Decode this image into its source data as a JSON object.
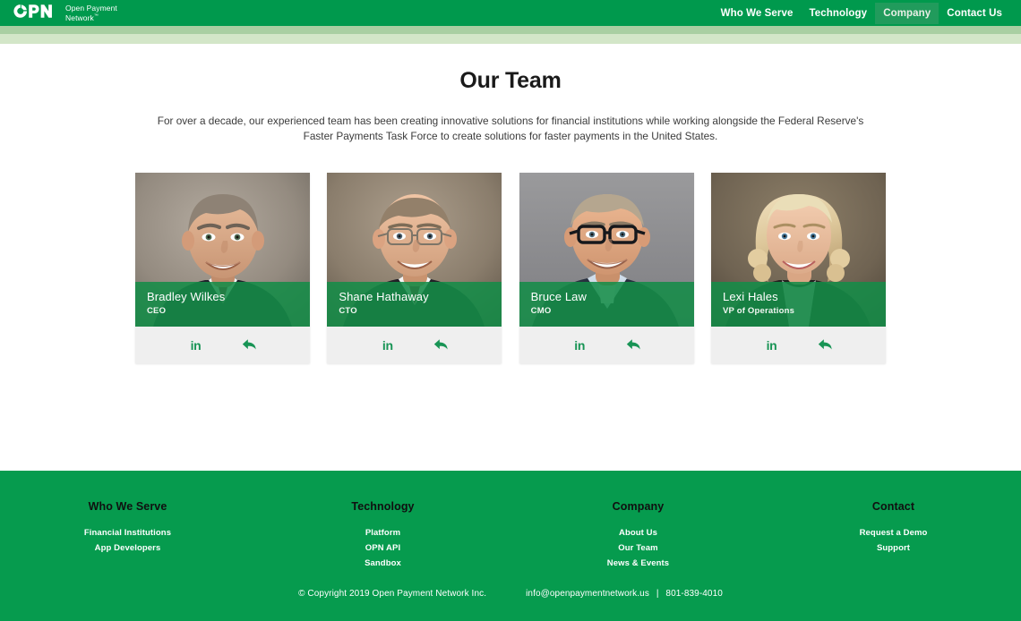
{
  "header": {
    "logo": {
      "mark": "opn-monogram",
      "line1": "Open Payment",
      "line2": "Network",
      "tm": "™"
    },
    "nav": [
      {
        "label": "Who We Serve",
        "active": false
      },
      {
        "label": "Technology",
        "active": false
      },
      {
        "label": "Company",
        "active": true
      },
      {
        "label": "Contact Us",
        "active": false
      }
    ]
  },
  "main": {
    "title": "Our Team",
    "subtitle": "For over a decade, our experienced team has been creating innovative solutions for financial institutions while working alongside the Federal Reserve's Faster Payments Task Force to create solutions for faster payments in the United States.",
    "team": [
      {
        "name": "Bradley Wilkes",
        "role": "CEO",
        "linkedin_label": "in",
        "share_label": "share-arrow"
      },
      {
        "name": "Shane Hathaway",
        "role": "CTO",
        "linkedin_label": "in",
        "share_label": "share-arrow"
      },
      {
        "name": "Bruce Law",
        "role": "CMO",
        "linkedin_label": "in",
        "share_label": "share-arrow"
      },
      {
        "name": "Lexi Hales",
        "role": "VP of Operations",
        "linkedin_label": "in",
        "share_label": "share-arrow"
      }
    ]
  },
  "footer": {
    "columns": [
      {
        "heading": "Who We Serve",
        "links": [
          "Financial Institutions",
          "App Developers"
        ]
      },
      {
        "heading": "Technology",
        "links": [
          "Platform",
          "OPN API",
          "Sandbox"
        ]
      },
      {
        "heading": "Company",
        "links": [
          "About Us",
          "Our Team",
          "News & Events"
        ]
      },
      {
        "heading": "Contact",
        "links": [
          "Request a Demo",
          "Support"
        ]
      }
    ],
    "copyright": "© Copyright 2019 Open Payment Network Inc.",
    "email": "info@openpaymentnetwork.us",
    "separator": "|",
    "phone": "801-839-4010"
  },
  "colors": {
    "header_green": "#00994d",
    "band_mid": "#a9cfa2",
    "band_light": "#d3e6c8",
    "footer_green": "#069b4e",
    "nameplate_green": "#148c48",
    "icon_green": "#189455",
    "social_bar": "#efefef"
  }
}
